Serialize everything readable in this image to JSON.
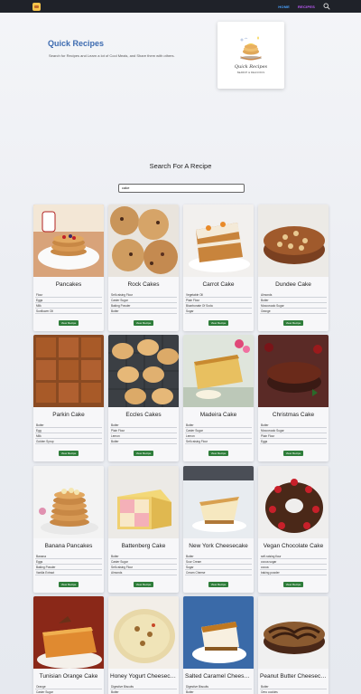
{
  "nav": {
    "home": "HOME",
    "recipes": "RECIPES"
  },
  "hero": {
    "title": "Quick Recipes",
    "description": "Search for Recipes and Learn a lot of Cool Meals, and Share them with others.",
    "logo_name": "Quick Recipes",
    "logo_sub": "SEARCH & DELICIOUS"
  },
  "search": {
    "heading": "Search For A Recipe",
    "value": "cake"
  },
  "view_label": "View Recipe",
  "colors": {
    "nav_bg": "#1f2229",
    "home": "#4aa3ff",
    "recipes": "#c35cff",
    "title": "#3d6bb0",
    "button": "#2e7d3a"
  },
  "recipes": [
    {
      "title": "Pancakes",
      "ingredients": [
        "Flour",
        "Eggs",
        "Milk",
        "Sunflower Oil"
      ],
      "image": "pancakes-photo"
    },
    {
      "title": "Rock Cakes",
      "ingredients": [
        "Self-raising Flour",
        "Caster Sugar",
        "Baking Powder",
        "Butter"
      ],
      "image": "rock-cakes-photo"
    },
    {
      "title": "Carrot Cake",
      "ingredients": [
        "Vegetable Oil",
        "Plain Flour",
        "Bicarbonate Of Soda",
        "Sugar"
      ],
      "image": "carrot-cake-photo"
    },
    {
      "title": "Dundee Cake",
      "ingredients": [
        "Almonds",
        "Butter",
        "Muscovado Sugar",
        "Orange"
      ],
      "image": "dundee-cake-photo"
    },
    {
      "title": "Parkin Cake",
      "ingredients": [
        "Butter",
        "Egg",
        "Milk",
        "Golden Syrup"
      ],
      "image": "parkin-cake-photo"
    },
    {
      "title": "Eccles Cakes",
      "ingredients": [
        "Butter",
        "Plain Flour",
        "Lemon",
        "Butter"
      ],
      "image": "eccles-cakes-photo"
    },
    {
      "title": "Madeira Cake",
      "ingredients": [
        "Butter",
        "Caster Sugar",
        "Lemon",
        "Self-raising Flour"
      ],
      "image": "madeira-cake-photo"
    },
    {
      "title": "Christmas Cake",
      "ingredients": [
        "Butter",
        "Muscovado Sugar",
        "Plain Flour",
        "Eggs"
      ],
      "image": "christmas-cake-photo"
    },
    {
      "title": "Banana Pancakes",
      "ingredients": [
        "Banana",
        "Eggs",
        "Baking Powder",
        "Vanilla Extract"
      ],
      "image": "banana-pancakes-photo"
    },
    {
      "title": "Battenberg Cake",
      "ingredients": [
        "Butter",
        "Caster Sugar",
        "Self-raising Flour",
        "Almonds"
      ],
      "image": "battenberg-cake-photo"
    },
    {
      "title": "New York Cheesecake",
      "ingredients": [
        "Butter",
        "Sour Cream",
        "Sugar",
        "Cream Cheese"
      ],
      "image": "new-york-cheesecake-photo"
    },
    {
      "title": "Vegan Chocolate Cake",
      "ingredients": [
        "self-raising flour",
        "cocoa sugar",
        "cocoa",
        "baking powder"
      ],
      "image": "vegan-chocolate-cake-photo"
    },
    {
      "title": "Tunisian Orange Cake",
      "ingredients": [
        "Orange",
        "Caster Sugar"
      ],
      "image": "tunisian-orange-cake-photo"
    },
    {
      "title": "Honey Yogurt Cheesecake",
      "ingredients": [
        "Digestive Biscuits",
        "Butter"
      ],
      "image": "honey-yogurt-cheesecake-photo"
    },
    {
      "title": "Salted Caramel Cheesecake",
      "ingredients": [
        "Digestive Biscuits",
        "Butter"
      ],
      "image": "salted-caramel-cheesecake-photo"
    },
    {
      "title": "Peanut Butter Cheesecake",
      "ingredients": [
        "Butter",
        "Oreo cookies"
      ],
      "image": "peanut-butter-cheesecake-photo"
    }
  ]
}
